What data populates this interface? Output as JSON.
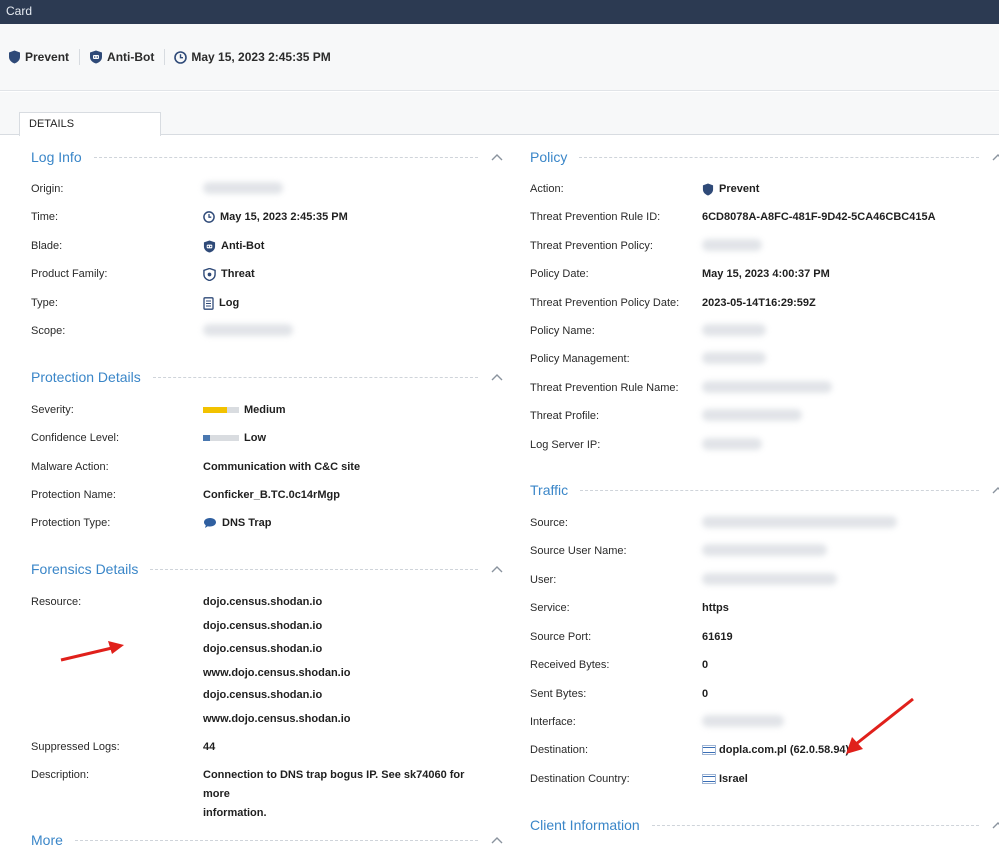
{
  "window": {
    "title": "Card"
  },
  "toolbar": {
    "action": "Prevent",
    "blade": "Anti-Bot",
    "time": "May 15, 2023 2:45:35 PM"
  },
  "tabs": [
    {
      "label": "DETAILS"
    }
  ],
  "log_info": {
    "title": "Log Info",
    "origin_label": "Origin:",
    "time_label": "Time:",
    "time_value": "May 15, 2023 2:45:35 PM",
    "blade_label": "Blade:",
    "blade_value": "Anti-Bot",
    "family_label": "Product Family:",
    "family_value": "Threat",
    "type_label": "Type:",
    "type_value": "Log",
    "scope_label": "Scope:"
  },
  "protection": {
    "title": "Protection Details",
    "severity_label": "Severity:",
    "severity_value": "Medium",
    "confidence_label": "Confidence Level:",
    "confidence_value": "Low",
    "malware_label": "Malware Action:",
    "malware_value": "Communication with C&C site",
    "name_label": "Protection Name:",
    "name_value": "Conficker_B.TC.0c14rMgp",
    "ptype_label": "Protection Type:",
    "ptype_value": "DNS Trap"
  },
  "forensics": {
    "title": "Forensics Details",
    "resource_label": "Resource:",
    "resources": [
      "dojo.census.shodan.io",
      "dojo.census.shodan.io",
      "dojo.census.shodan.io",
      "www.dojo.census.shodan.io",
      "dojo.census.shodan.io",
      "www.dojo.census.shodan.io"
    ],
    "suppressed_label": "Suppressed Logs:",
    "suppressed_value": "44",
    "description_label": "Description:",
    "description_line1": "Connection to DNS trap bogus IP. See sk74060 for more",
    "description_line2": "information."
  },
  "more": {
    "title": "More"
  },
  "policy": {
    "title": "Policy",
    "action_label": "Action:",
    "action_value": "Prevent",
    "rule_id_label": "Threat Prevention Rule ID:",
    "rule_id_value": "6CD8078A-A8FC-481F-9D42-5CA46CBC415A",
    "tp_policy_label": "Threat Prevention Policy:",
    "policy_date_label": "Policy Date:",
    "policy_date_value": "May 15, 2023 4:00:37 PM",
    "tp_policy_date_label": "Threat Prevention Policy Date:",
    "tp_policy_date_value": "2023-05-14T16:29:59Z",
    "policy_name_label": "Policy Name:",
    "policy_mgmt_label": "Policy Management:",
    "rule_name_label": "Threat Prevention Rule Name:",
    "profile_label": "Threat Profile:",
    "log_server_label": "Log Server IP:"
  },
  "traffic": {
    "title": "Traffic",
    "source_label": "Source:",
    "source_user_label": "Source User Name:",
    "user_label": "User:",
    "service_label": "Service:",
    "service_value": "https",
    "source_port_label": "Source Port:",
    "source_port_value": "61619",
    "received_label": "Received Bytes:",
    "received_value": "0",
    "sent_label": "Sent Bytes:",
    "sent_value": "0",
    "interface_label": "Interface:",
    "destination_label": "Destination:",
    "destination_value": "dopla.com.pl (62.0.58.94)",
    "dest_country_label": "Destination Country:",
    "dest_country_value": "Israel"
  },
  "client": {
    "title": "Client Information"
  },
  "colors": {
    "accent": "#3a86c8",
    "titlebar": "#2c3a52",
    "severity": "#f2c200",
    "confidence": "#4a78b0",
    "arrow": "#e0201b"
  }
}
